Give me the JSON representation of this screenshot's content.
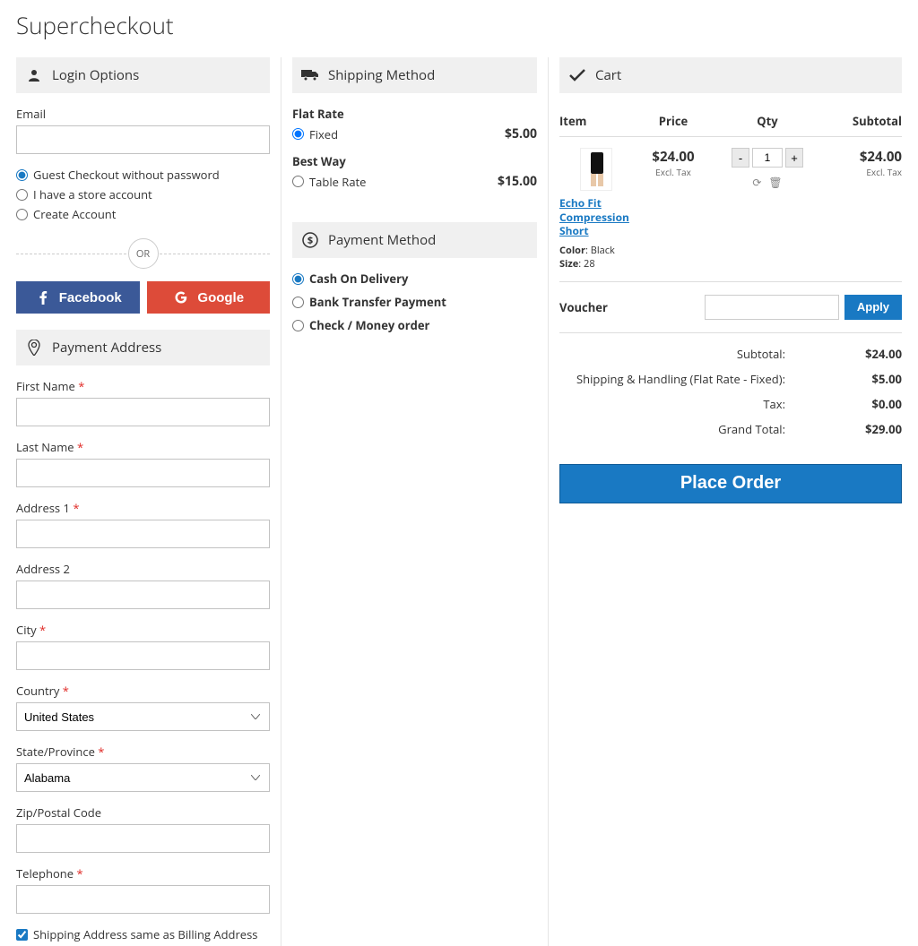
{
  "page_title": "Supercheckout",
  "login": {
    "header": "Login Options",
    "email_label": "Email",
    "options": [
      {
        "label": "Guest Checkout without password",
        "checked": true
      },
      {
        "label": "I have a store account",
        "checked": false
      },
      {
        "label": "Create Account",
        "checked": false
      }
    ],
    "or_label": "OR",
    "facebook": "Facebook",
    "google": "Google"
  },
  "address": {
    "header": "Payment Address",
    "first_name": "First Name",
    "last_name": "Last Name",
    "address1": "Address 1",
    "address2": "Address 2",
    "city": "City",
    "country_label": "Country",
    "country_value": "United States",
    "state_label": "State/Province",
    "state_value": "Alabama",
    "zip": "Zip/Postal Code",
    "telephone": "Telephone",
    "same_as_billing": "Shipping Address same as Billing Address"
  },
  "shipping": {
    "header": "Shipping Method",
    "groups": [
      {
        "title": "Flat Rate",
        "option": "Fixed",
        "price": "$5.00",
        "checked": true
      },
      {
        "title": "Best Way",
        "option": "Table Rate",
        "price": "$15.00",
        "checked": false
      }
    ]
  },
  "payment": {
    "header": "Payment Method",
    "options": [
      {
        "label": "Cash On Delivery",
        "checked": true
      },
      {
        "label": "Bank Transfer Payment",
        "checked": false
      },
      {
        "label": "Check / Money order",
        "checked": false
      }
    ]
  },
  "cart": {
    "header": "Cart",
    "cols": {
      "item": "Item",
      "price": "Price",
      "qty": "Qty",
      "subtotal": "Subtotal"
    },
    "item": {
      "name": "Echo Fit Compression Short",
      "color_label": "Color",
      "color_value": "Black",
      "size_label": "Size",
      "size_value": "28",
      "price": "$24.00",
      "excl": "Excl. Tax",
      "qty": "1",
      "subtotal": "$24.00"
    },
    "voucher_label": "Voucher",
    "apply": "Apply",
    "totals": [
      {
        "label": "Subtotal:",
        "value": "$24.00"
      },
      {
        "label": "Shipping & Handling (Flat Rate - Fixed):",
        "value": "$5.00"
      },
      {
        "label": "Tax:",
        "value": "$0.00"
      },
      {
        "label": "Grand Total:",
        "value": "$29.00"
      }
    ],
    "place_order": "Place Order"
  }
}
